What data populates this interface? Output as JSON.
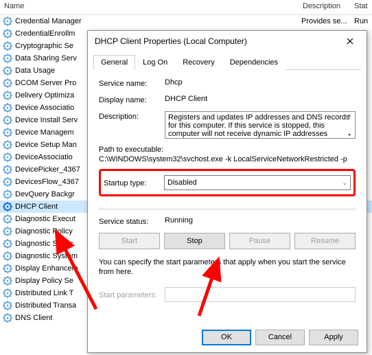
{
  "columns": {
    "name": "Name",
    "desc": "Description",
    "stat": "Stat"
  },
  "services": [
    {
      "label": "Credential Manager",
      "desc": "Provides se...",
      "stat": "Run"
    },
    {
      "label": "CredentialEnrollm"
    },
    {
      "label": "Cryptographic Se"
    },
    {
      "label": "Data Sharing Serv"
    },
    {
      "label": "Data Usage"
    },
    {
      "label": "DCOM Server Pro"
    },
    {
      "label": "Delivery Optimiza"
    },
    {
      "label": "Device Associatio"
    },
    {
      "label": "Device Install Serv"
    },
    {
      "label": "Device Managem"
    },
    {
      "label": "Device Setup Man"
    },
    {
      "label": "DeviceAssociatio"
    },
    {
      "label": "DevicePicker_4367"
    },
    {
      "label": "DevicesFlow_4367"
    },
    {
      "label": "DevQuery Backgr"
    },
    {
      "label": "DHCP Client",
      "selected": true
    },
    {
      "label": "Diagnostic Execut"
    },
    {
      "label": "Diagnostic Policy"
    },
    {
      "label": "Diagnostic Servic"
    },
    {
      "label": "Diagnostic System"
    },
    {
      "label": "Display Enhancem"
    },
    {
      "label": "Display Policy Se"
    },
    {
      "label": "Distributed Link T"
    },
    {
      "label": "Distributed Transa"
    },
    {
      "label": "DNS Client"
    }
  ],
  "dialog": {
    "title": "DHCP Client Properties (Local Computer)",
    "tabs": [
      "General",
      "Log On",
      "Recovery",
      "Dependencies"
    ],
    "active_tab": 0,
    "labels": {
      "service_name": "Service name:",
      "display_name": "Display name:",
      "description": "Description:",
      "path_label": "Path to executable:",
      "startup_type": "Startup type:",
      "service_status": "Service status:",
      "start_params_label": "Start parameters:"
    },
    "service_name": "Dhcp",
    "display_name": "DHCP Client",
    "description": "Registers and updates IP addresses and DNS records for this computer. If this service is stopped, this computer will not receive dynamic IP addresses",
    "exec_path": "C:\\WINDOWS\\system32\\svchost.exe -k LocalServiceNetworkRestricted -p",
    "startup_value": "Disabled",
    "status_value": "Running",
    "buttons": {
      "start": "Start",
      "stop": "Stop",
      "pause": "Pause",
      "resume": "Resume"
    },
    "hint": "You can specify the start parameters that apply when you start the service from here.",
    "start_params": "",
    "dlg_buttons": {
      "ok": "OK",
      "cancel": "Cancel",
      "apply": "Apply"
    }
  }
}
